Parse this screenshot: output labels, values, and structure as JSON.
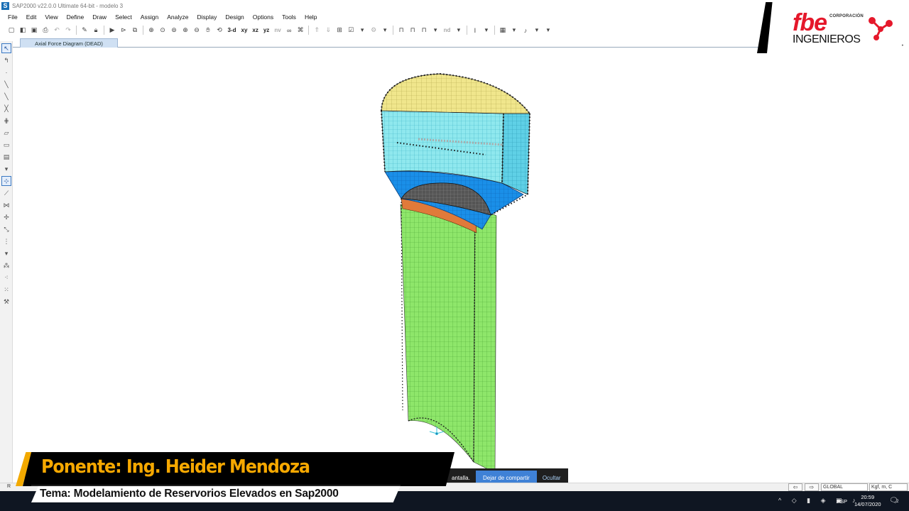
{
  "window": {
    "title": "SAP2000 v22.0.0 Ultimate 64-bit - modelo 3",
    "app_icon_letter": "S"
  },
  "menu": [
    "File",
    "Edit",
    "View",
    "Define",
    "Draw",
    "Select",
    "Assign",
    "Analyze",
    "Display",
    "Design",
    "Options",
    "Tools",
    "Help"
  ],
  "toolbar": {
    "view_3d": "3-d",
    "view_xy": "xy",
    "view_xz": "xz",
    "view_yz": "yz",
    "view_nv": "nv",
    "view_nd": "nd"
  },
  "tabs": {
    "active": "Axial Force Diagram (DEAD)"
  },
  "logo": {
    "corp": "CORPORACIÓN",
    "brand": "fbe",
    "sub": "INGENIEROS"
  },
  "share_bar": {
    "text": "antalla.",
    "stop_label": "Dejar de compartir",
    "hide_label": "Ocultar"
  },
  "status": {
    "left": "R",
    "coordinate_system": "GLOBAL",
    "units": "Kgf, m, C"
  },
  "taskbar": {
    "language": "ESP",
    "time": "20:59",
    "date": "14/07/2020",
    "notifications": "2"
  },
  "banner": {
    "speaker": "Ponente: Ing. Heider Mendoza",
    "topic": "Tema: Modelamiento de Reservorios Elevados en Sap2000"
  },
  "colors": {
    "roof": "#f0e68c",
    "tank_wall": "#8fe8ee",
    "tank_wall_dark": "#5fd0e6",
    "tank_bottom": "#1a8fe8",
    "shaft": "#8ee66a",
    "ring_beam": "#e07a3a",
    "brand_red": "#e5182b",
    "banner_orange": "#f6a800"
  }
}
